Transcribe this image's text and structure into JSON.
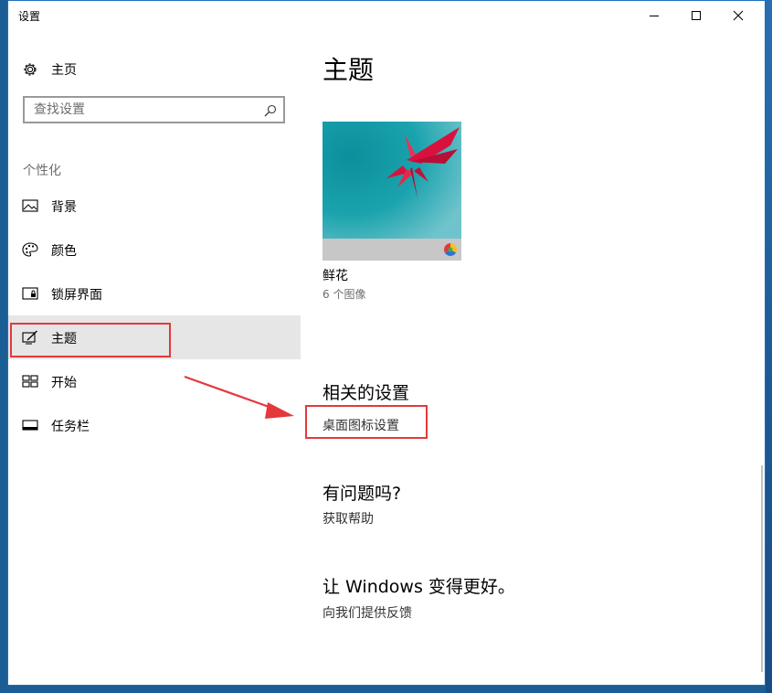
{
  "window": {
    "title": "设置"
  },
  "titlebar": {
    "minimize_icon": "minimize-icon",
    "maximize_icon": "maximize-icon",
    "close_icon": "close-icon"
  },
  "sidebar": {
    "home_label": "主页",
    "home_icon": "gear-icon",
    "search_placeholder": "查找设置",
    "search_icon": "search-icon",
    "section_label": "个性化",
    "items": [
      {
        "label": "背景",
        "icon": "image-icon"
      },
      {
        "label": "颜色",
        "icon": "palette-icon"
      },
      {
        "label": "锁屏界面",
        "icon": "lock-screen-icon"
      },
      {
        "label": "主题",
        "icon": "theme-brush-icon",
        "selected": true
      },
      {
        "label": "开始",
        "icon": "start-grid-icon"
      },
      {
        "label": "任务栏",
        "icon": "taskbar-icon"
      }
    ]
  },
  "main": {
    "page_title": "主题",
    "theme": {
      "name": "鲜花",
      "count": "6 个图像",
      "badge_icon": "color-wheel-icon"
    },
    "related": {
      "heading": "相关的设置",
      "link": "桌面图标设置"
    },
    "help": {
      "heading": "有问题吗?",
      "link": "获取帮助"
    },
    "feedback": {
      "heading": "让 Windows 变得更好。",
      "link": "向我们提供反馈"
    }
  },
  "annotation": {
    "color": "#e5383b",
    "arrow_icon": "arrow-icon"
  },
  "colors": {
    "selected_bg": "#e6e6e6",
    "desktop": "#1b5e96"
  }
}
